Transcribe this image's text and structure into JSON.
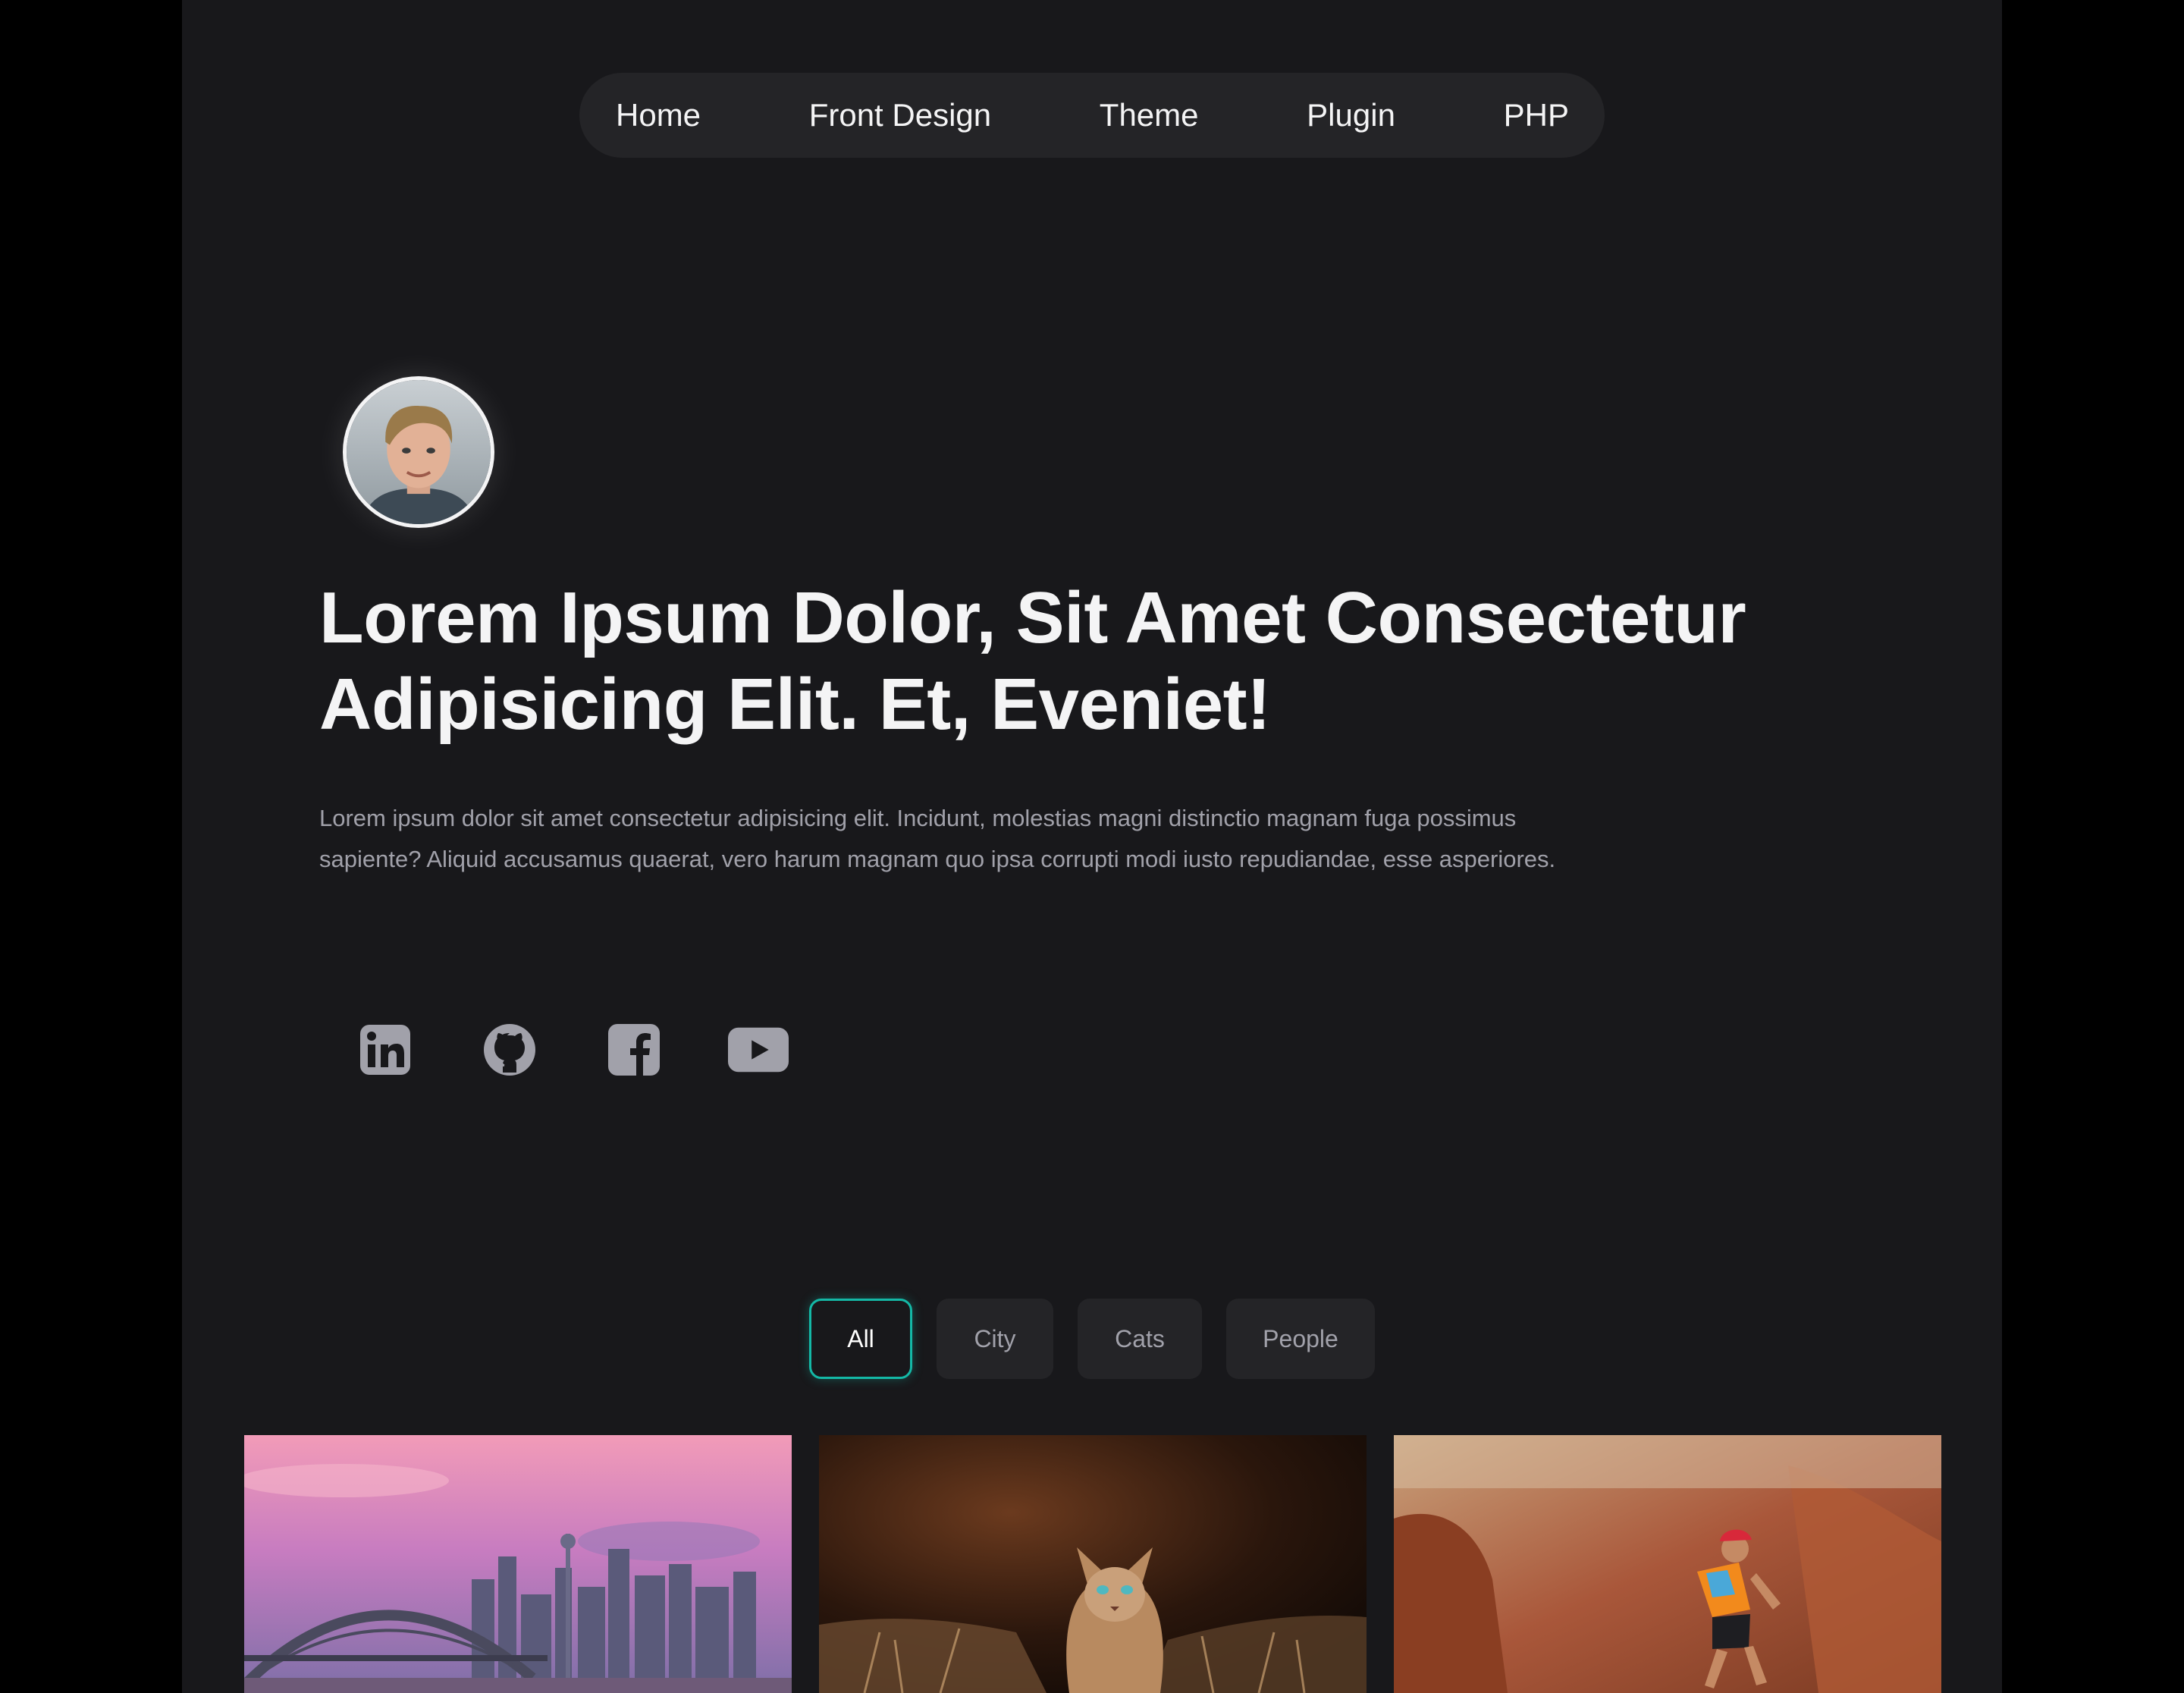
{
  "nav": {
    "items": [
      "Home",
      "Front Design",
      "Theme",
      "Plugin",
      "PHP"
    ]
  },
  "hero": {
    "avatar_alt": "Profile photo",
    "title_line1": "Lorem Ipsum Dolor, Sit Amet Consectetur",
    "title_line2": "Adipisicing Elit. Et, Eveniet!",
    "description": "Lorem ipsum dolor sit amet consectetur adipisicing elit. Incidunt, molestias magni distinctio magnam fuga possimus sapiente? Aliquid accusamus quaerat, vero harum magnam quo ipsa corrupti modi iusto repudiandae, esse asperiores."
  },
  "socials": [
    {
      "icon": "linkedin-icon"
    },
    {
      "icon": "github-icon"
    },
    {
      "icon": "facebook-icon"
    },
    {
      "icon": "youtube-icon"
    }
  ],
  "filters": {
    "items": [
      "All",
      "City",
      "Cats",
      "People"
    ],
    "active": "All"
  },
  "gallery": [
    {
      "category": "City",
      "icon": "city-skyline-image"
    },
    {
      "category": "Cats",
      "icon": "cat-image"
    },
    {
      "category": "People",
      "icon": "runner-image"
    }
  ],
  "colors": {
    "page_bg": "#18181b",
    "outer_bg": "#000000",
    "surface": "#242427",
    "text": "#f4f4f5",
    "muted": "#a1a1aa",
    "accent": "#14b8a6"
  }
}
